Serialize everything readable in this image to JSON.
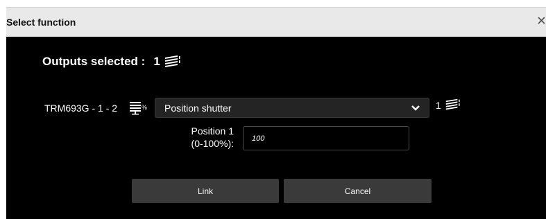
{
  "dialog": {
    "title": "Select function",
    "close_glyph": "×"
  },
  "outputs": {
    "label": "Outputs selected :",
    "count": "1",
    "icon": "outputs-stack-icon"
  },
  "row": {
    "device_label": "TRM693G - 1 - 2",
    "device_icon": "shutter-percent-icon",
    "function_select": {
      "value": "Position shutter",
      "icon": "chevron-down-icon"
    },
    "right_count": "1",
    "right_icon": "outputs-stack-icon"
  },
  "position": {
    "label_line1": "Position 1",
    "label_line2": "(0-100%):",
    "value": "100"
  },
  "buttons": {
    "link_label": "Link",
    "cancel_label": "Cancel"
  },
  "colors": {
    "titlebar": "#e9e9e9",
    "body": "#000000",
    "button": "#3a3a3a",
    "select": "#242424"
  }
}
